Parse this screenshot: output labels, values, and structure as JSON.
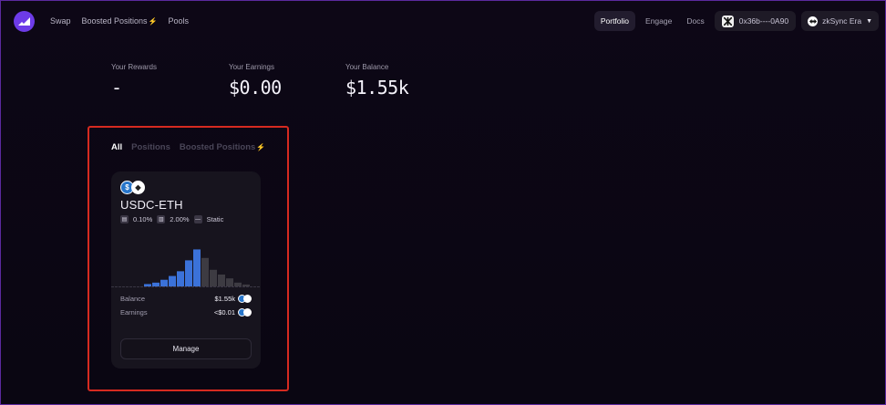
{
  "nav": {
    "items": [
      "Swap",
      "Boosted Positions",
      "Pools"
    ],
    "boost_glyph": "⚡"
  },
  "right_nav": {
    "portfolio": "Portfolio",
    "engage": "Engage",
    "docs": "Docs",
    "wallet_address": "0x36b----0A90",
    "network": "zkSync Era"
  },
  "stats": {
    "rewards": {
      "label": "Your Rewards",
      "value": "-"
    },
    "earnings": {
      "label": "Your Earnings",
      "value": "$0.00"
    },
    "balance": {
      "label": "Your Balance",
      "value": "$1.55k"
    }
  },
  "filters": {
    "all": "All",
    "positions": "Positions",
    "boosted": "Boosted Positions"
  },
  "position": {
    "pair": "USDC-ETH",
    "fee": "0.10%",
    "range": "2.00%",
    "mode": "Static",
    "balance_label": "Balance",
    "balance_value": "$1.55k",
    "earnings_label": "Earnings",
    "earnings_value": "<$0.01",
    "manage_label": "Manage",
    "token_a_glyph": "$",
    "token_b_glyph": "◆"
  },
  "liquidity_chart": {
    "in_range": [
      0.05,
      0.08,
      0.14,
      0.22,
      0.32,
      0.55,
      0.78
    ],
    "out_range": [
      0.6,
      0.35,
      0.25,
      0.17,
      0.08,
      0.04
    ],
    "colors": {
      "in": "#3b72d9",
      "out": "#3d3b42",
      "baseline": "#3a3644"
    }
  },
  "colors": {
    "accent": "#6d3be8",
    "highlight": "#d62a20",
    "bolt": "#a86bff"
  }
}
